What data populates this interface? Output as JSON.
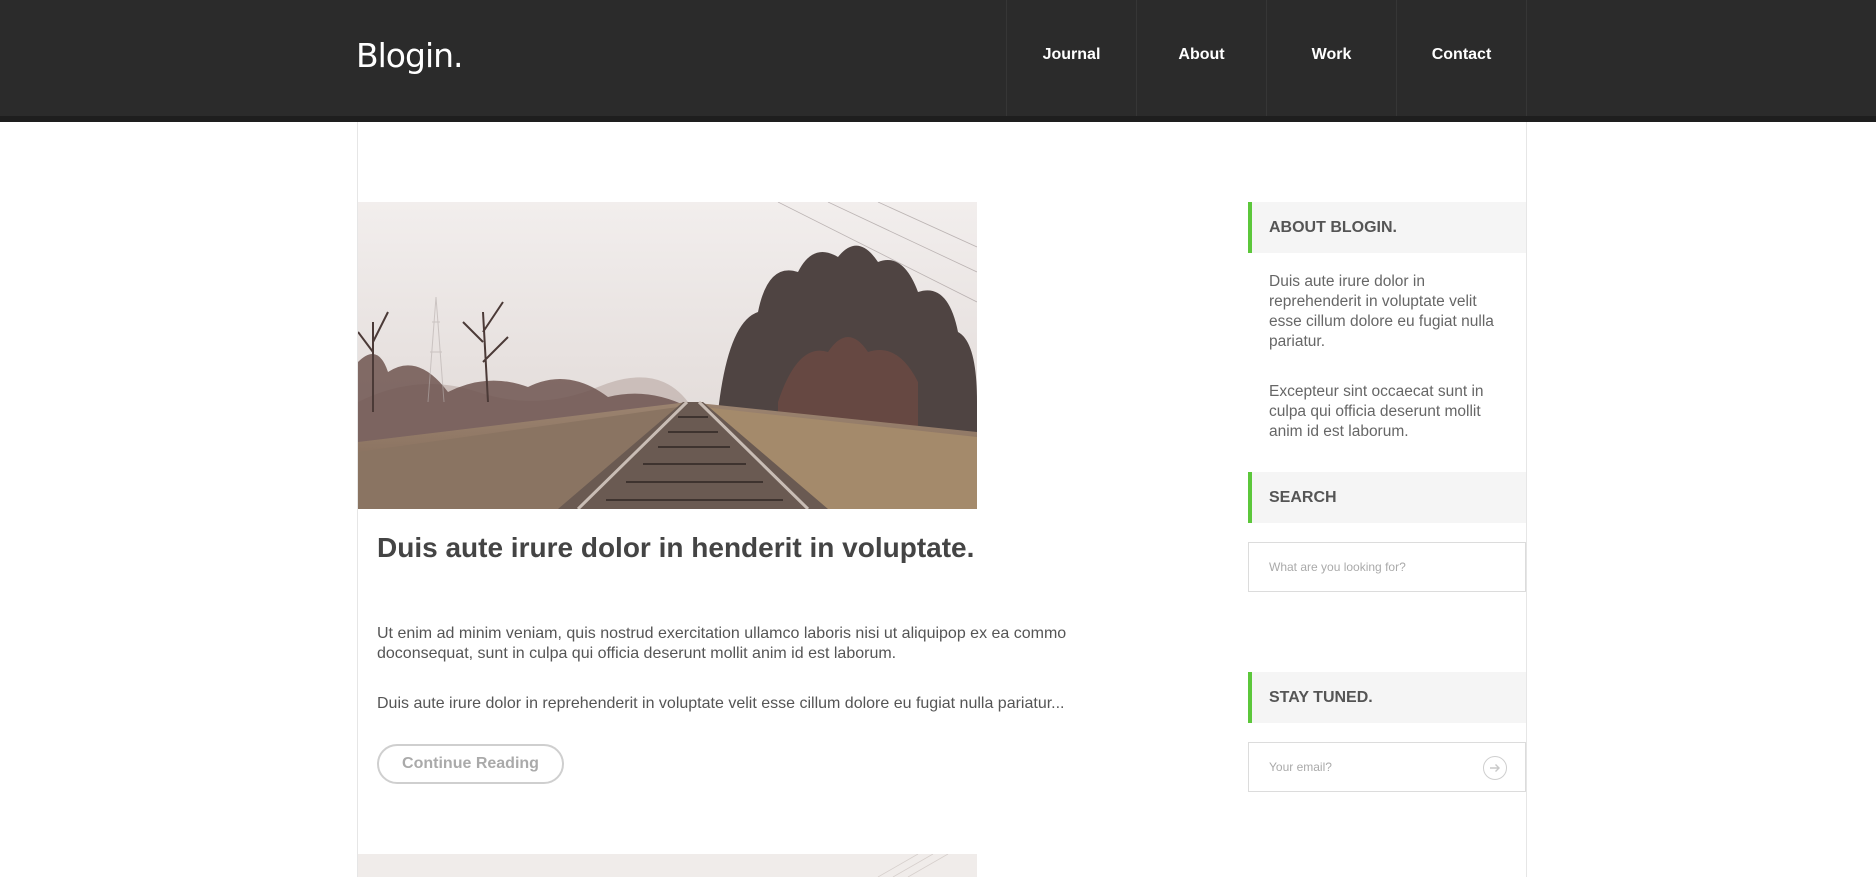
{
  "header": {
    "logo": "Blogin.",
    "nav": [
      "Journal",
      "About",
      "Work",
      "Contact"
    ]
  },
  "post": {
    "title": "Duis aute irure dolor in henderit in voluptate.",
    "paragraph1": "Ut enim ad minim veniam, quis nostrud exercitation ullamco laboris nisi ut aliquipop ex ea commo doconsequat, sunt in culpa qui officia deserunt mollit anim id est laborum.",
    "paragraph2": "Duis aute irure dolor in reprehenderit in voluptate velit esse cillum dolore eu fugiat nulla pariatur...",
    "button": "Continue Reading"
  },
  "sidebar": {
    "about": {
      "title": "ABOUT BLOGIN.",
      "text1": "Duis aute irure dolor in reprehenderit in voluptate velit esse cillum dolore eu fugiat nulla pariatur.",
      "text2": "Excepteur sint occaecat sunt in culpa qui officia deserunt mollit anim id est laborum."
    },
    "search": {
      "title": "SEARCH",
      "placeholder": "What are you looking for?"
    },
    "stay_tuned": {
      "title": "STAY TUNED.",
      "placeholder": "Your email?"
    }
  },
  "colors": {
    "header_bg": "#2b2b2b",
    "accent": "#5cc73b"
  },
  "icons": {
    "submit": "arrow-right-circle-icon"
  }
}
